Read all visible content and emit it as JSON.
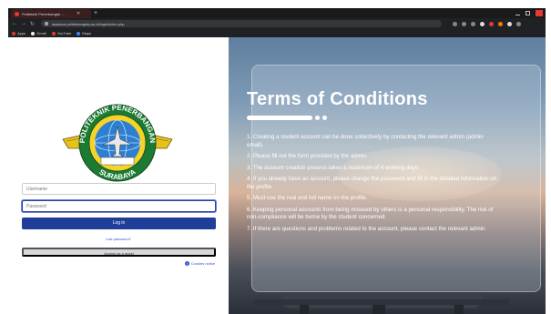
{
  "browser": {
    "tab_title": "Politeknik Penerbangan ...",
    "url": "aaaduca.poltekbangsby.ac.id/login/index.php",
    "bookmarks": [
      {
        "label": "Apps",
        "color": "#e53935"
      },
      {
        "label": "Gmail",
        "color": "#f2f2f2"
      },
      {
        "label": "YouTube",
        "color": "#e53935"
      },
      {
        "label": "Maps",
        "color": "#4285f4"
      }
    ]
  },
  "login": {
    "username_placeholder": "Username",
    "password_placeholder": "Password",
    "login_button": "Log in",
    "lost_password": "Lost password?",
    "guest_button": "Access as a guest",
    "cookies_notice": "Cookies notice",
    "logo_top_text": "POLITEKNIK PENERBANGAN",
    "logo_bottom_text": "SURABAYA"
  },
  "terms": {
    "title": "Terms of Conditions",
    "items": [
      "1. Creating a student account can be done collectively by contacting the relevant admin (admin email).",
      "2. Please fill out the form provided by the admin.",
      "3. The account creation process takes a maximum of 4 working days.",
      "4. If you already have an account, please change the password and fill in the detailed information on the profile.",
      "5. Must use the real and full name on the profile.",
      "6. Keeping personal accounts from being misused by others is a personal responsibility. The risk of non-compliance will be borne by the student concerned.",
      "7. If there are questions and problems related to the account, please contact the relevant admin."
    ]
  },
  "colors": {
    "primary": "#1f3e9a",
    "link": "#2f56c9"
  }
}
